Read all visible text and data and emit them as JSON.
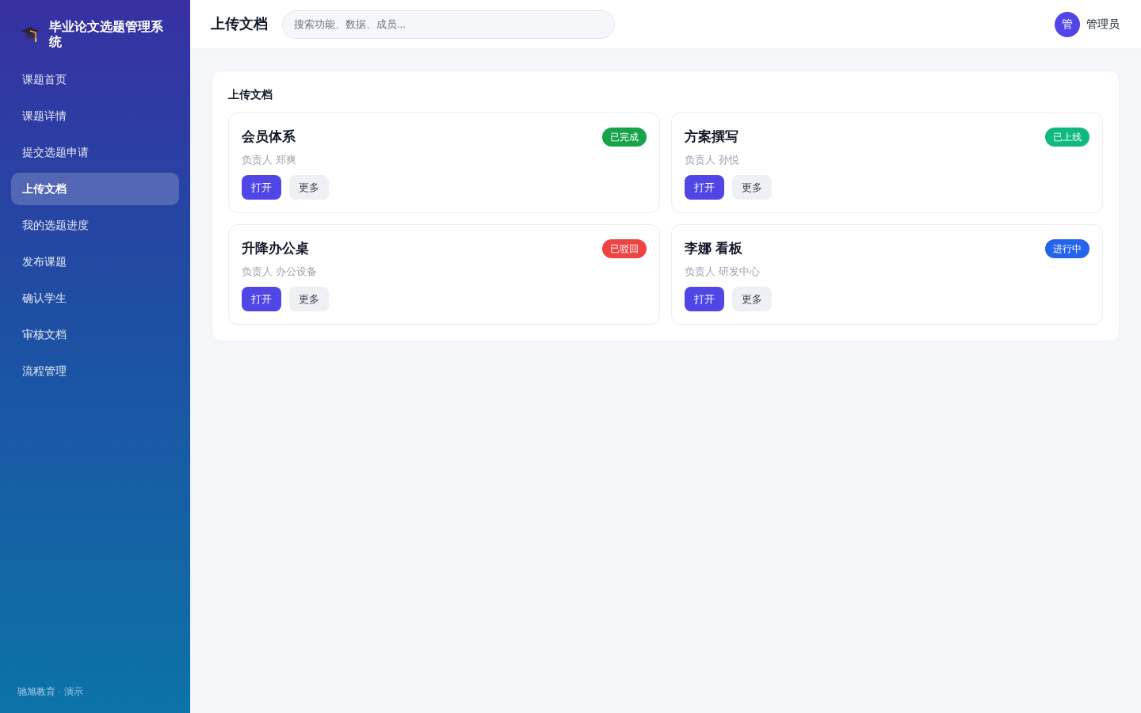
{
  "sidebar": {
    "brand": "毕业论文选题管理系统",
    "items": [
      {
        "label": "课题首页",
        "selected": false
      },
      {
        "label": "课题详情",
        "selected": false
      },
      {
        "label": "提交选题申请",
        "selected": false
      },
      {
        "label": "上传文档",
        "selected": true
      },
      {
        "label": "我的选题进度",
        "selected": false
      },
      {
        "label": "发布课题",
        "selected": false
      },
      {
        "label": "确认学生",
        "selected": false
      },
      {
        "label": "审核文档",
        "selected": false
      },
      {
        "label": "流程管理",
        "selected": false
      }
    ],
    "footer": "驰旭教育 · 演示"
  },
  "header": {
    "title": "上传文档",
    "search": {
      "placeholder": "搜索功能、数据、成员..."
    },
    "user": {
      "avatar": "管",
      "name": "管理员"
    }
  },
  "panel": {
    "title": "上传文档",
    "cards": [
      {
        "title": "会员体系",
        "status": {
          "label": "已完成",
          "color": "#16a34a"
        },
        "owner": "负责人 郑爽",
        "buttons": [
          {
            "label": "打开",
            "kind": "primary"
          },
          {
            "label": "更多",
            "kind": "secondary"
          }
        ]
      },
      {
        "title": "方案撰写",
        "status": {
          "label": "已上线",
          "color": "#10b981"
        },
        "owner": "负责人 孙悦",
        "buttons": [
          {
            "label": "打开",
            "kind": "primary"
          },
          {
            "label": "更多",
            "kind": "secondary"
          }
        ]
      },
      {
        "title": "升降办公桌",
        "status": {
          "label": "已驳回",
          "color": "#ef4444"
        },
        "owner": "负责人 办公设备",
        "buttons": [
          {
            "label": "打开",
            "kind": "primary"
          },
          {
            "label": "更多",
            "kind": "secondary"
          }
        ]
      },
      {
        "title": "李娜 看板",
        "status": {
          "label": "进行中",
          "color": "#2563eb"
        },
        "owner": "负责人 研发中心",
        "buttons": [
          {
            "label": "打开",
            "kind": "primary"
          },
          {
            "label": "更多",
            "kind": "secondary"
          }
        ]
      }
    ]
  }
}
